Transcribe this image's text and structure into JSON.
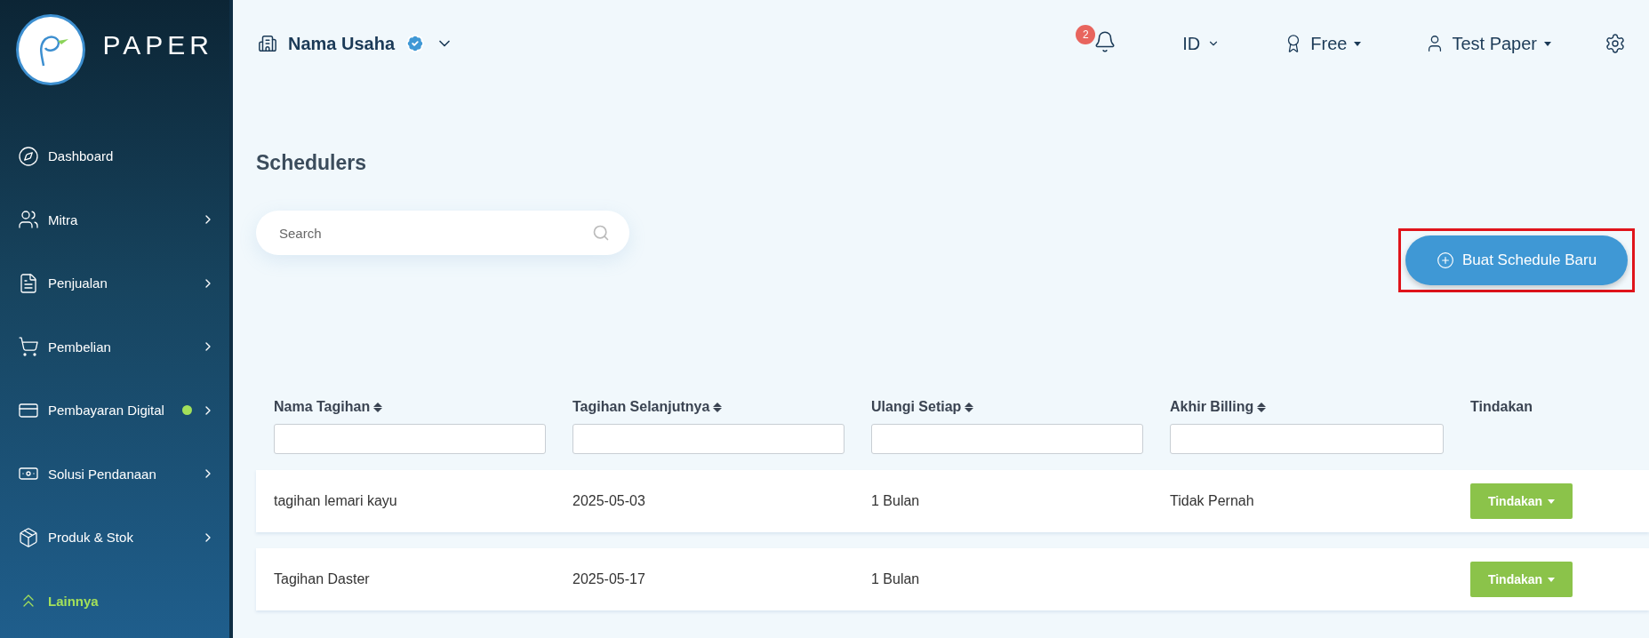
{
  "brand": {
    "name": "PAPER"
  },
  "sidebar": {
    "items": [
      {
        "label": "Dashboard",
        "selected": false,
        "has_submenu": false
      },
      {
        "label": "Mitra",
        "selected": false,
        "has_submenu": true
      },
      {
        "label": "Penjualan",
        "selected": false,
        "has_submenu": true
      },
      {
        "label": "Pembelian",
        "selected": false,
        "has_submenu": true
      },
      {
        "label": "Pembayaran Digital",
        "selected": false,
        "has_submenu": true,
        "color": "#a3e05a"
      },
      {
        "label": "Solusi Pendanaan",
        "selected": false,
        "has_submenu": true
      },
      {
        "label": "Produk & Stok",
        "selected": false,
        "has_submenu": true
      },
      {
        "label": "Lainnya",
        "selected": true,
        "has_submenu": false
      }
    ]
  },
  "header": {
    "business_name": "Nama Usaha",
    "verified": true,
    "notification_count": "2",
    "language": "ID",
    "plan": "Free",
    "user": "Test Paper"
  },
  "page": {
    "title": "Schedulers",
    "search": {
      "placeholder": "Search"
    },
    "create_button": "Buat Schedule Baru",
    "create_button_highlighted": true
  },
  "table": {
    "columns": [
      {
        "label": "Nama Tagihan",
        "sortable": true,
        "filter": true
      },
      {
        "label": "Tagihan Selanjutnya",
        "sortable": true,
        "filter": true
      },
      {
        "label": "Ulangi Setiap",
        "sortable": true,
        "filter": true
      },
      {
        "label": "Akhir Billing",
        "sortable": true,
        "filter": true
      },
      {
        "label": "Tindakan",
        "sortable": false,
        "filter": false
      }
    ],
    "rows": [
      {
        "cells": [
          "tagihan lemari kayu",
          "2025-05-03",
          "1 Bulan",
          "Tidak Pernah"
        ],
        "action": "Tindakan"
      },
      {
        "cells": [
          "Tagihan Daster",
          "2025-05-17",
          "1 Bulan",
          ""
        ],
        "action": "Tindakan"
      }
    ]
  }
}
